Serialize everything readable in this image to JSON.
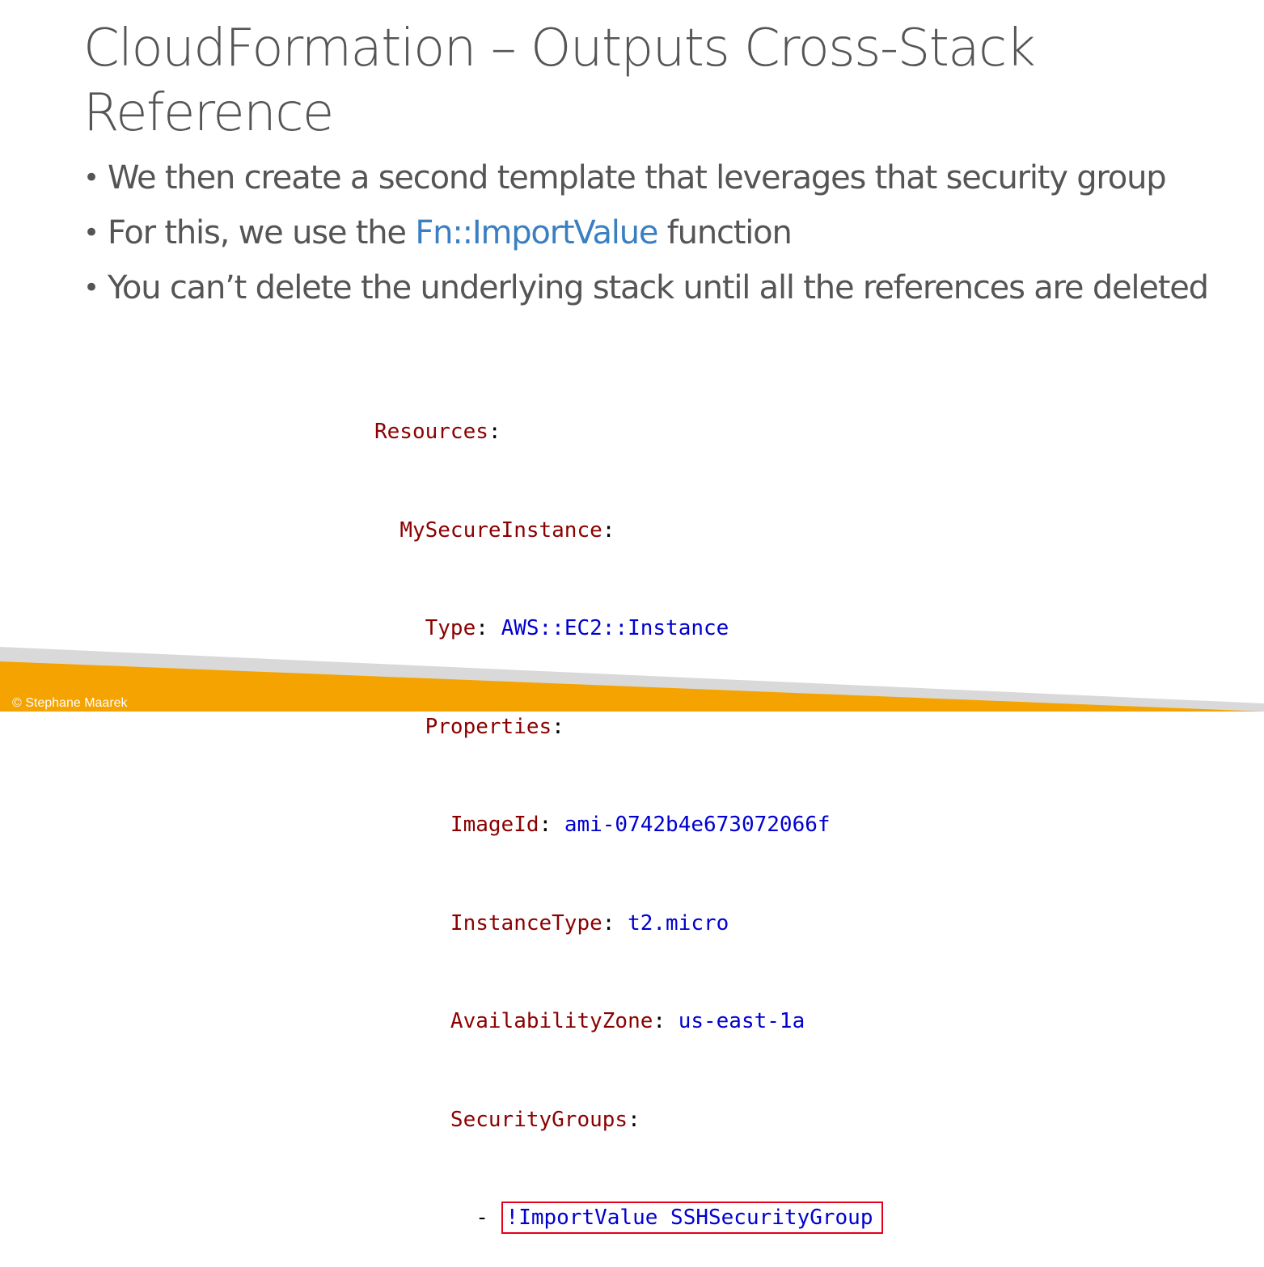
{
  "slide": {
    "title": "CloudFormation – Outputs Cross-Stack Reference",
    "bullets": [
      {
        "text": "We then create a second template that leverages that security group"
      },
      {
        "before": "For this, we use the ",
        "highlight": "Fn::ImportValue",
        "after": " function"
      },
      {
        "text": "You can’t delete the underlying stack until all the references are deleted"
      }
    ],
    "bullet_symbol": "•"
  },
  "code": {
    "lines": [
      {
        "indent": "",
        "key": "Resources",
        "sep": ":",
        "value": ""
      },
      {
        "indent": "  ",
        "key": "MySecureInstance",
        "sep": ":",
        "value": ""
      },
      {
        "indent": "    ",
        "key": "Type",
        "sep": ": ",
        "value": "AWS::EC2::Instance"
      },
      {
        "indent": "    ",
        "key": "Properties",
        "sep": ":",
        "value": ""
      },
      {
        "indent": "      ",
        "key": "ImageId",
        "sep": ": ",
        "value": "ami-0742b4e673072066f"
      },
      {
        "indent": "      ",
        "key": "InstanceType",
        "sep": ": ",
        "value": "t2.micro"
      },
      {
        "indent": "      ",
        "key": "AvailabilityZone",
        "sep": ": ",
        "value": "us-east-1a"
      },
      {
        "indent": "      ",
        "key": "SecurityGroups",
        "sep": ":",
        "value": ""
      }
    ],
    "import_line": {
      "indent": "        ",
      "dash": "- ",
      "value": "!ImportValue SSHSecurityGroup"
    }
  },
  "footer": {
    "copyright": "© Stephane Maarek"
  },
  "colors": {
    "title_text": "#555555",
    "highlight": "#3a7fc1",
    "code_key": "#8b0000",
    "code_value": "#0000d0",
    "highlight_box": "#e3001b",
    "footer_orange": "#f5a300",
    "footer_gray": "#d9d9d9"
  }
}
